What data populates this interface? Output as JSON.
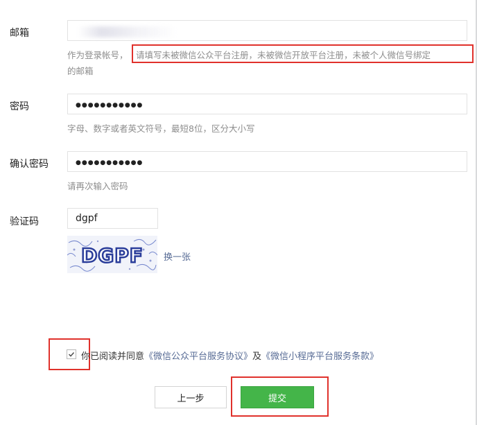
{
  "form": {
    "email": {
      "label": "邮箱",
      "value": "",
      "hint_prefix": "作为登录帐号，",
      "hint_highlight": "请填写未被微信公众平台注册，未被微信开放平台注册，未被个人微信号绑定",
      "hint_suffix": "的邮箱"
    },
    "password": {
      "label": "密码",
      "value": "●●●●●●●●●●●",
      "hint": "字母、数字或者英文符号，最短8位，区分大小写"
    },
    "confirm_password": {
      "label": "确认密码",
      "value": "●●●●●●●●●●●",
      "hint": "请再次输入密码"
    },
    "captcha": {
      "label": "验证码",
      "value": "dgpf",
      "image_text": "DGPF",
      "refresh_link": "换一张"
    }
  },
  "agreement": {
    "checked": true,
    "text": "你已阅读并同意",
    "link1": "《微信公众平台服务协议》",
    "and": "及",
    "link2": "《微信小程序平台服务条款》"
  },
  "buttons": {
    "prev": "上一步",
    "submit": "提交"
  },
  "colors": {
    "primary_green": "#44b549",
    "link_blue": "#576b95",
    "annotation_red": "#e0312b",
    "hint_gray": "#8d8d8d"
  },
  "icons": [
    "check-icon",
    "captcha-image",
    "email-blur"
  ]
}
